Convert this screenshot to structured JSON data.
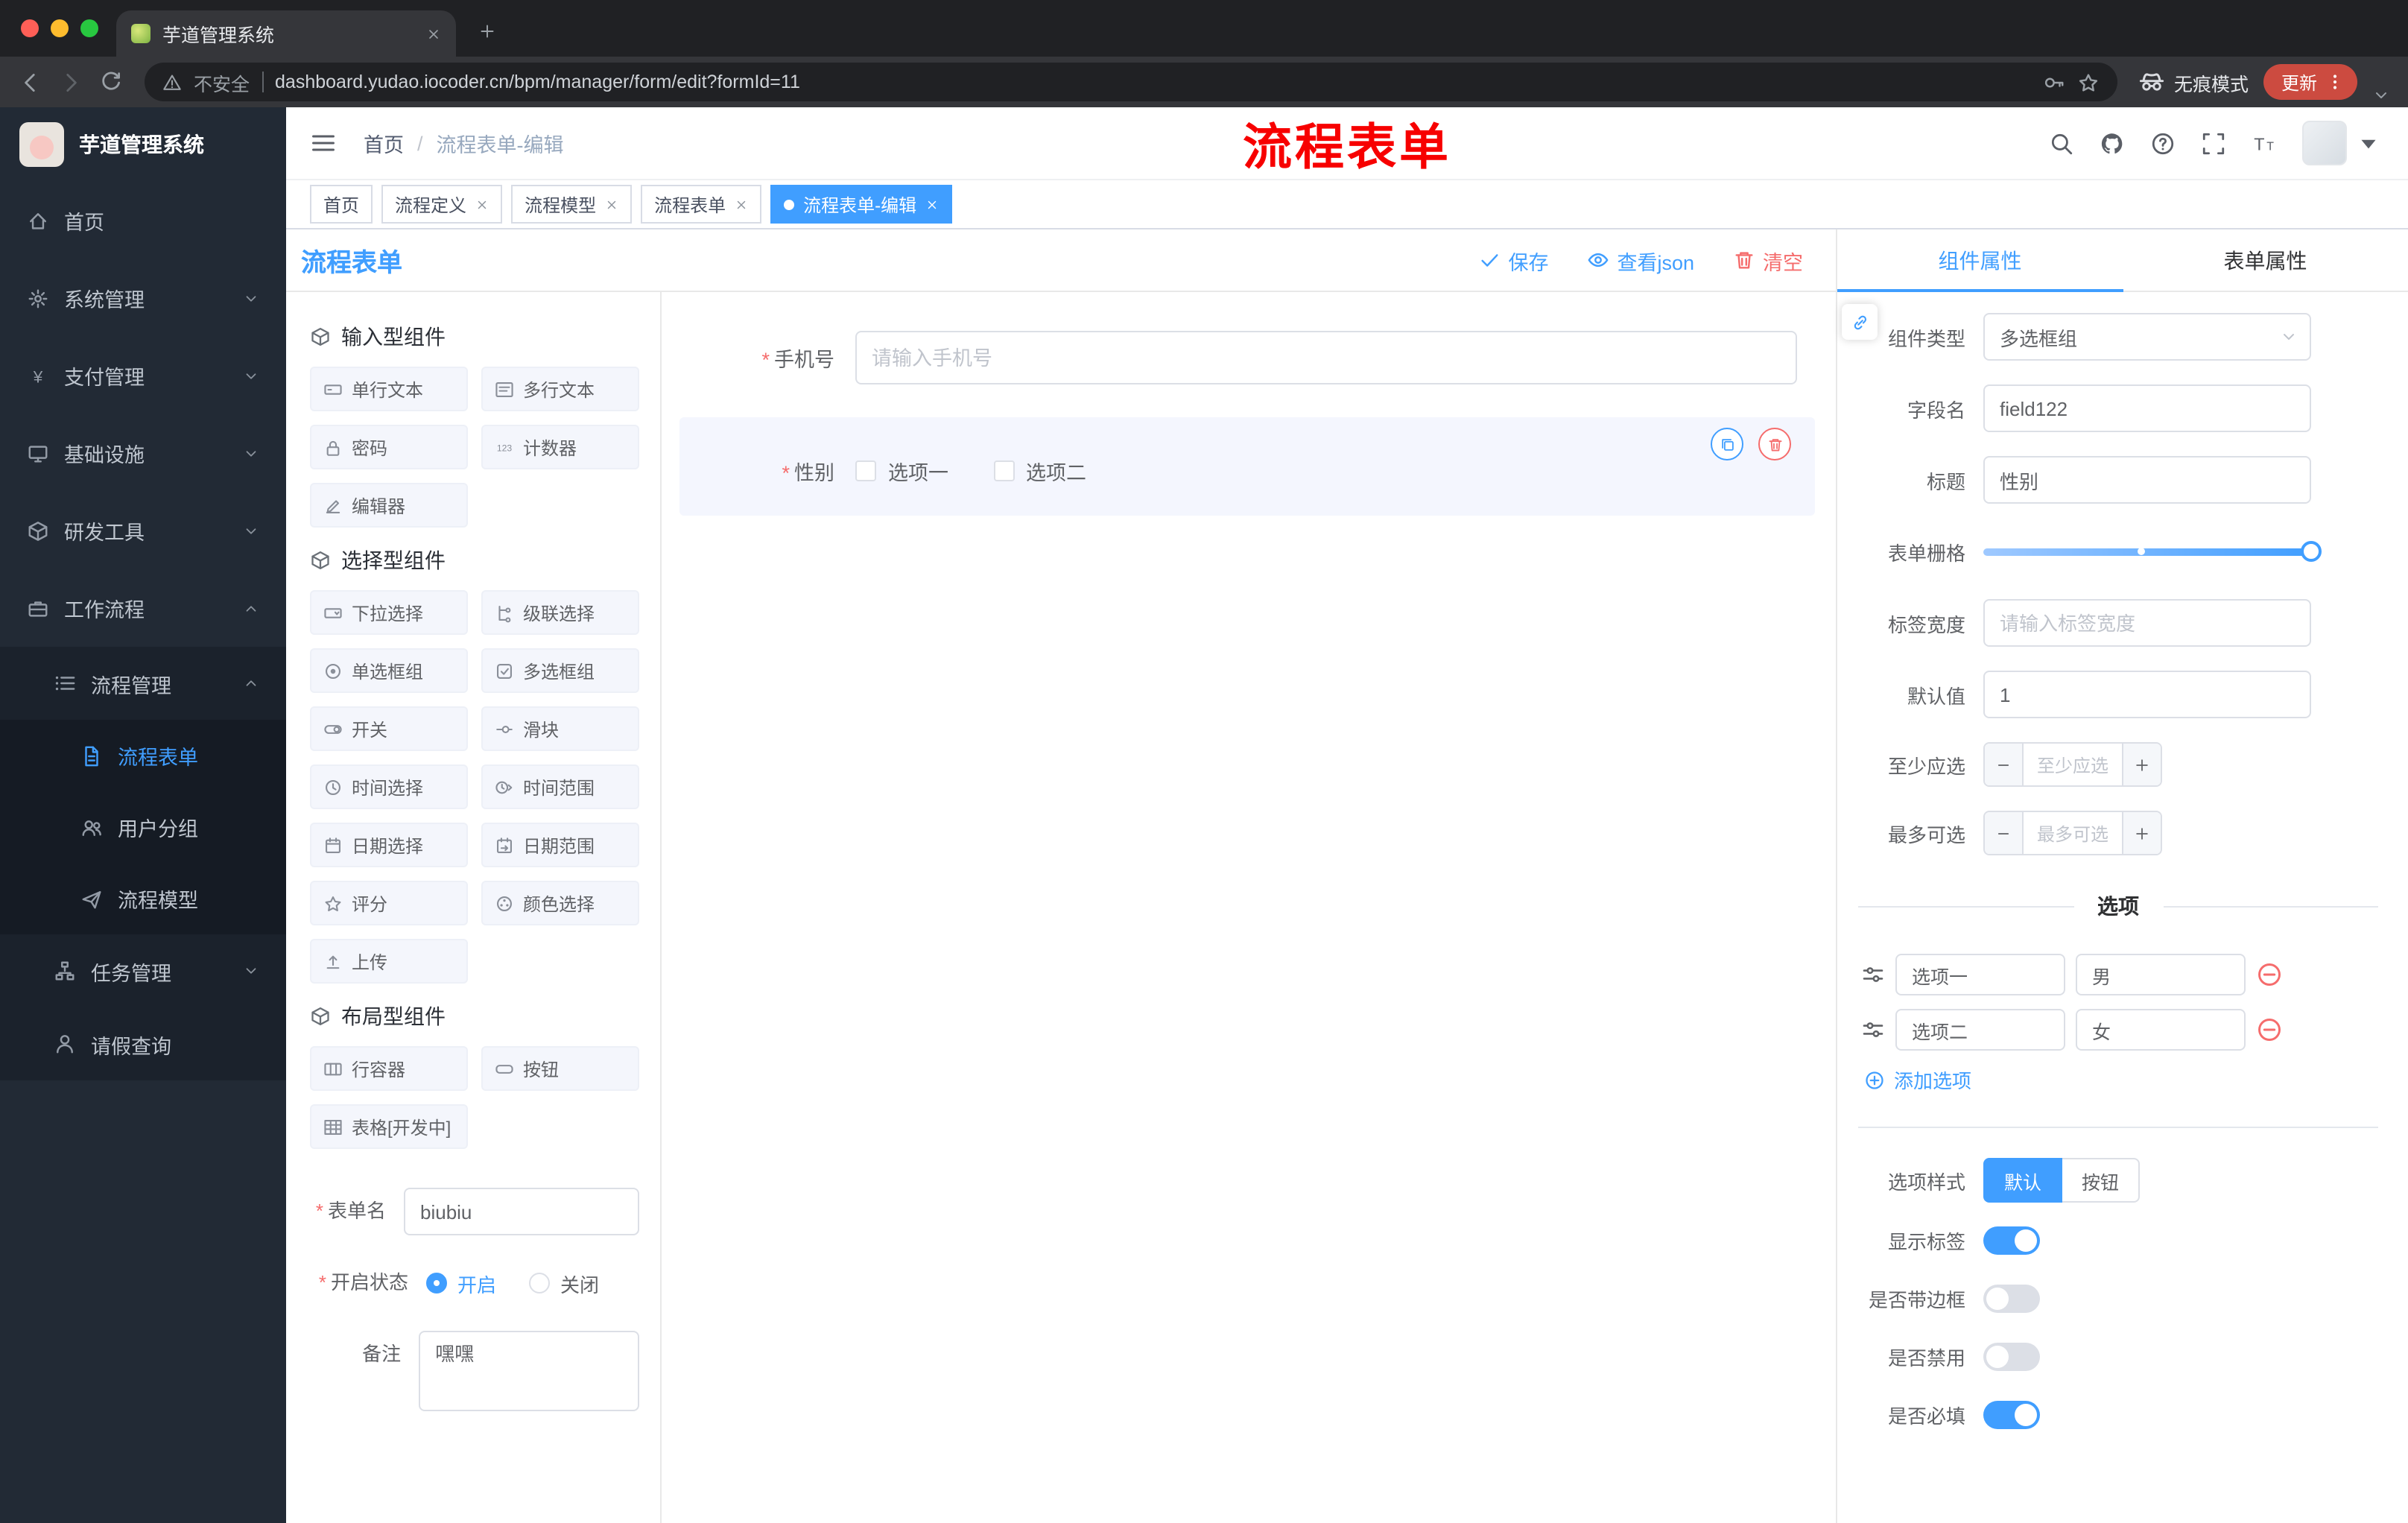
{
  "browser": {
    "tab_title": "芋道管理系统",
    "security": "不安全",
    "url": "dashboard.yudao.iocoder.cn/bpm/manager/form/edit?formId=11",
    "incognito": "无痕模式",
    "update": "更新"
  },
  "sidebar": {
    "logo_title": "芋道管理系统",
    "items": [
      {
        "label": "首页"
      },
      {
        "label": "系统管理"
      },
      {
        "label": "支付管理"
      },
      {
        "label": "基础设施"
      },
      {
        "label": "研发工具"
      },
      {
        "label": "工作流程"
      },
      {
        "label": "流程管理"
      },
      {
        "label": "流程表单"
      },
      {
        "label": "用户分组"
      },
      {
        "label": "流程模型"
      },
      {
        "label": "任务管理"
      },
      {
        "label": "请假查询"
      }
    ]
  },
  "header": {
    "breadcrumb_home": "首页",
    "breadcrumb_sep": "/",
    "breadcrumb_current": "流程表单-编辑",
    "annotation": "流程表单"
  },
  "tags": [
    {
      "label": "首页"
    },
    {
      "label": "流程定义"
    },
    {
      "label": "流程模型"
    },
    {
      "label": "流程表单"
    },
    {
      "label": "流程表单-编辑"
    }
  ],
  "designer": {
    "title": "流程表单",
    "save": "保存",
    "view_json": "查看json",
    "clear": "清空",
    "sections": [
      {
        "title": "输入型组件",
        "items": [
          "单行文本",
          "多行文本",
          "密码",
          "计数器",
          "编辑器"
        ]
      },
      {
        "title": "选择型组件",
        "items": [
          "下拉选择",
          "级联选择",
          "单选框组",
          "多选框组",
          "开关",
          "滑块",
          "时间选择",
          "时间范围",
          "日期选择",
          "日期范围",
          "评分",
          "颜色选择",
          "上传"
        ]
      },
      {
        "title": "布局型组件",
        "items": [
          "行容器",
          "按钮",
          "表格[开发中]"
        ]
      }
    ],
    "meta": {
      "name_label": "表单名",
      "name_value": "biubiu",
      "status_label": "开启状态",
      "status_on": "开启",
      "status_off": "关闭",
      "remark_label": "备注",
      "remark_value": "嘿嘿"
    },
    "canvas": {
      "phone_label": "手机号",
      "phone_placeholder": "请输入手机号",
      "gender_label": "性别",
      "gender_option1": "选项一",
      "gender_option2": "选项二"
    }
  },
  "props": {
    "tab_component": "组件属性",
    "tab_form": "表单属性",
    "type_label": "组件类型",
    "type_value": "多选框组",
    "field_label": "字段名",
    "field_value": "field122",
    "title_label": "标题",
    "title_value": "性别",
    "grid_label": "表单栅格",
    "width_label": "标签宽度",
    "width_placeholder": "请输入标签宽度",
    "default_label": "默认值",
    "default_value": "1",
    "min_label": "至少应选",
    "min_placeholder": "至少应选",
    "max_label": "最多可选",
    "max_placeholder": "最多可选",
    "options_title": "选项",
    "options": [
      {
        "label": "选项一",
        "value": "男"
      },
      {
        "label": "选项二",
        "value": "女"
      }
    ],
    "add_option": "添加选项",
    "style_label": "选项样式",
    "style_default": "默认",
    "style_button": "按钮",
    "show_label_label": "显示标签",
    "border_label": "是否带边框",
    "disabled_label": "是否禁用",
    "required_label": "是否必填"
  }
}
